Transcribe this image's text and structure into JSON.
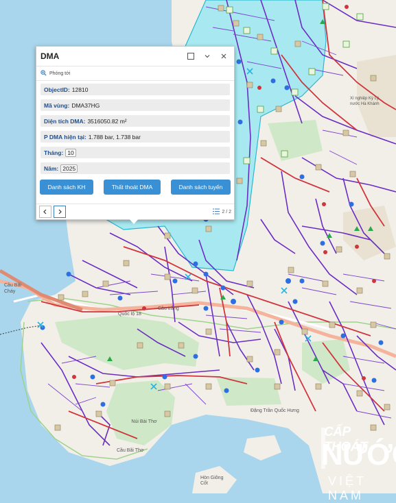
{
  "popup": {
    "title": "DMA",
    "zoom_label": "Phóng tới",
    "fields": [
      {
        "label": "ObjectID:",
        "value": "12810"
      },
      {
        "label": "Mã vùng:",
        "value": "DMA37HG"
      },
      {
        "label": "Diện tích DMA:",
        "value": "3516050.82 m²"
      },
      {
        "label": "P DMA hiện tại:",
        "value": "1.788 bar, 1.738 bar"
      },
      {
        "label": "Tháng:",
        "value": "10"
      },
      {
        "label": "Năm:",
        "value": "2025"
      }
    ],
    "buttons": [
      "Danh sách KH",
      "Thất thoát DMA",
      "Danh sách tuyến"
    ],
    "pager": "2 / 2"
  },
  "map_labels": {
    "cau_bai_chay": "Cầu Bãi Cháy",
    "ql18": "Quốc lộ 18",
    "cau_tram": "Cầu trắng",
    "nui_bai_tho": "Núi Bài Thơ",
    "hon_giong": "Hòn Giông Cốt",
    "dang_tran": "Đặng Trần Quốc Hưng",
    "cau_bai_tho": "Cầu Bãi Thơ",
    "ke_khanh": "Xí nghiệp Kỳ Lý nước Hà Khánh"
  },
  "watermark": {
    "line1": "CẤP THOÁT",
    "line2": "NƯỚC",
    "line3": "VIỆT NAM"
  },
  "colors": {
    "sea": "#a9d6ec",
    "land": "#f2efe9",
    "dma_fill": "#9be7f2",
    "pipe_main": "#d0343c",
    "pipe_sub": "#6a2cc2",
    "button": "#3a90d4"
  }
}
